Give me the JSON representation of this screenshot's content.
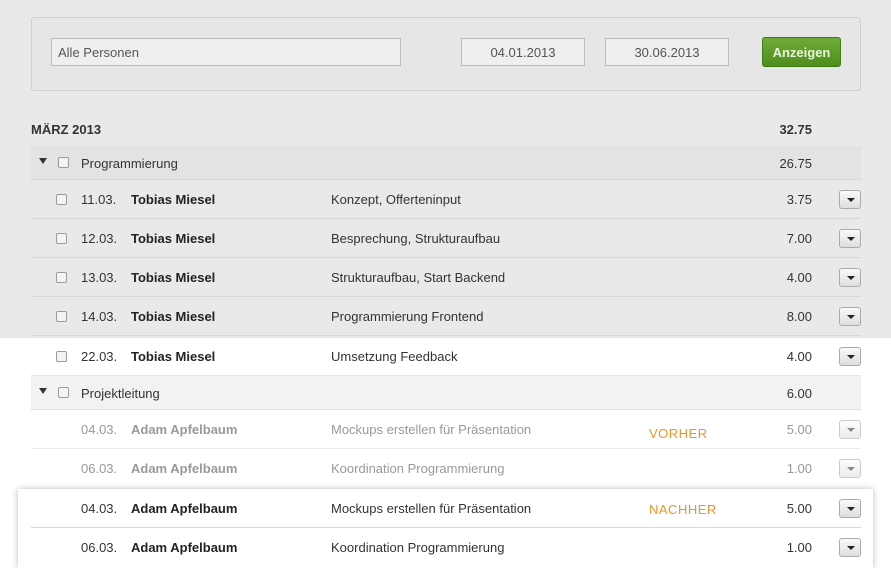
{
  "filters": {
    "person": "Alle Personen",
    "date_from": "04.01.2013",
    "date_to": "30.06.2013",
    "show_label": "Anzeigen"
  },
  "month": {
    "title": "MÄRZ 2013",
    "total": "32.75"
  },
  "groups": [
    {
      "label": "Programmierung",
      "total": "26.75",
      "entries": [
        {
          "date": "11.03.",
          "name": "Tobias Miesel",
          "desc": "Konzept, Offerteninput",
          "hours": "3.75"
        },
        {
          "date": "12.03.",
          "name": "Tobias Miesel",
          "desc": "Besprechung, Strukturaufbau",
          "hours": "7.00"
        },
        {
          "date": "13.03.",
          "name": "Tobias Miesel",
          "desc": "Strukturaufbau, Start Backend",
          "hours": "4.00"
        },
        {
          "date": "14.03.",
          "name": "Tobias Miesel",
          "desc": "Programmierung Frontend",
          "hours": "8.00"
        },
        {
          "date": "22.03.",
          "name": "Tobias Miesel",
          "desc": "Umsetzung Feedback",
          "hours": "4.00"
        }
      ]
    },
    {
      "label": "Projektleitung",
      "total": "6.00",
      "entries": [
        {
          "date": "04.03.",
          "name": "Adam Apfelbaum",
          "desc": "Mockups erstellen für Präsentation",
          "hours": "5.00"
        },
        {
          "date": "06.03.",
          "name": "Adam Apfelbaum",
          "desc": "Koordination Programmierung",
          "hours": "1.00"
        }
      ]
    }
  ],
  "after": {
    "entries": [
      {
        "date": "04.03.",
        "name": "Adam Apfelbaum",
        "desc": "Mockups erstellen für Präsentation",
        "hours": "5.00"
      },
      {
        "date": "06.03.",
        "name": "Adam Apfelbaum",
        "desc": "Koordination Programmierung",
        "hours": "1.00"
      }
    ]
  },
  "labels": {
    "before": "VORHER",
    "after": "NACHHER"
  },
  "colors": {
    "accent_green": "#5a9a27",
    "label_orange": "#e8962a"
  }
}
